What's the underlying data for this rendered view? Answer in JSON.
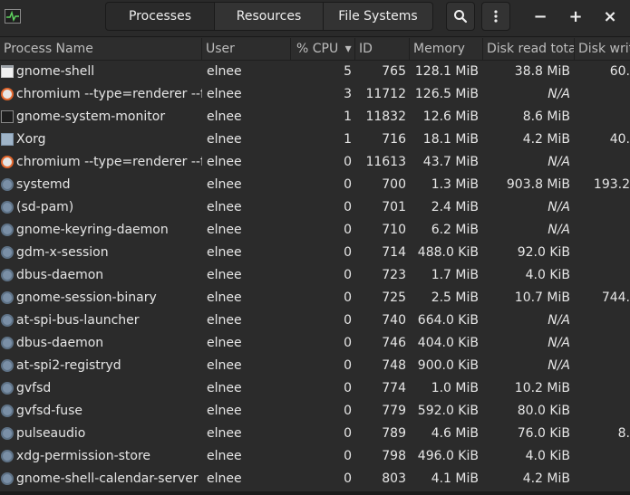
{
  "header": {
    "tabs": [
      {
        "label": "Processes",
        "active": true
      },
      {
        "label": "Resources",
        "active": false
      },
      {
        "label": "File Systems",
        "active": false
      }
    ],
    "search_icon": "search-icon",
    "menu_icon": "kebab-menu-icon",
    "minimize": "−",
    "maximize": "+",
    "close": "×"
  },
  "columns": [
    {
      "key": "name",
      "label": "Process Name"
    },
    {
      "key": "user",
      "label": "User"
    },
    {
      "key": "cpu",
      "label": "% CPU"
    },
    {
      "key": "id",
      "label": "ID"
    },
    {
      "key": "memory",
      "label": "Memory"
    },
    {
      "key": "disk_read",
      "label": "Disk read tota"
    },
    {
      "key": "disk_write",
      "label": "Disk writ"
    }
  ],
  "sort_indicator": "▾",
  "processes": [
    {
      "icon": "window",
      "name": "gnome-shell",
      "user": "elnee",
      "cpu": "5",
      "id": "765",
      "memory": "128.1 MiB",
      "disk_read": "38.8 MiB",
      "disk_write": "60."
    },
    {
      "icon": "chromium",
      "name": "chromium --type=renderer --f",
      "user": "elnee",
      "cpu": "3",
      "id": "11712",
      "memory": "126.5 MiB",
      "disk_read": "N/A",
      "disk_write": ""
    },
    {
      "icon": "monitor",
      "name": "gnome-system-monitor",
      "user": "elnee",
      "cpu": "1",
      "id": "11832",
      "memory": "12.6 MiB",
      "disk_read": "8.6 MiB",
      "disk_write": ""
    },
    {
      "icon": "xorg",
      "name": "Xorg",
      "user": "elnee",
      "cpu": "1",
      "id": "716",
      "memory": "18.1 MiB",
      "disk_read": "4.2 MiB",
      "disk_write": "40."
    },
    {
      "icon": "chromium",
      "name": "chromium --type=renderer --f",
      "user": "elnee",
      "cpu": "0",
      "id": "11613",
      "memory": "43.7 MiB",
      "disk_read": "N/A",
      "disk_write": ""
    },
    {
      "icon": "gear",
      "name": "systemd",
      "user": "elnee",
      "cpu": "0",
      "id": "700",
      "memory": "1.3 MiB",
      "disk_read": "903.8 MiB",
      "disk_write": "193.2"
    },
    {
      "icon": "gear",
      "name": "(sd-pam)",
      "user": "elnee",
      "cpu": "0",
      "id": "701",
      "memory": "2.4 MiB",
      "disk_read": "N/A",
      "disk_write": ""
    },
    {
      "icon": "gear",
      "name": "gnome-keyring-daemon",
      "user": "elnee",
      "cpu": "0",
      "id": "710",
      "memory": "6.2 MiB",
      "disk_read": "N/A",
      "disk_write": ""
    },
    {
      "icon": "gear",
      "name": "gdm-x-session",
      "user": "elnee",
      "cpu": "0",
      "id": "714",
      "memory": "488.0 KiB",
      "disk_read": "92.0 KiB",
      "disk_write": ""
    },
    {
      "icon": "gear",
      "name": "dbus-daemon",
      "user": "elnee",
      "cpu": "0",
      "id": "723",
      "memory": "1.7 MiB",
      "disk_read": "4.0 KiB",
      "disk_write": ""
    },
    {
      "icon": "gear",
      "name": "gnome-session-binary",
      "user": "elnee",
      "cpu": "0",
      "id": "725",
      "memory": "2.5 MiB",
      "disk_read": "10.7 MiB",
      "disk_write": "744."
    },
    {
      "icon": "gear",
      "name": "at-spi-bus-launcher",
      "user": "elnee",
      "cpu": "0",
      "id": "740",
      "memory": "664.0 KiB",
      "disk_read": "N/A",
      "disk_write": ""
    },
    {
      "icon": "gear",
      "name": "dbus-daemon",
      "user": "elnee",
      "cpu": "0",
      "id": "746",
      "memory": "404.0 KiB",
      "disk_read": "N/A",
      "disk_write": ""
    },
    {
      "icon": "gear",
      "name": "at-spi2-registryd",
      "user": "elnee",
      "cpu": "0",
      "id": "748",
      "memory": "900.0 KiB",
      "disk_read": "N/A",
      "disk_write": ""
    },
    {
      "icon": "gear",
      "name": "gvfsd",
      "user": "elnee",
      "cpu": "0",
      "id": "774",
      "memory": "1.0 MiB",
      "disk_read": "10.2 MiB",
      "disk_write": ""
    },
    {
      "icon": "gear",
      "name": "gvfsd-fuse",
      "user": "elnee",
      "cpu": "0",
      "id": "779",
      "memory": "592.0 KiB",
      "disk_read": "80.0 KiB",
      "disk_write": ""
    },
    {
      "icon": "gear",
      "name": "pulseaudio",
      "user": "elnee",
      "cpu": "0",
      "id": "789",
      "memory": "4.6 MiB",
      "disk_read": "76.0 KiB",
      "disk_write": "8."
    },
    {
      "icon": "gear",
      "name": "xdg-permission-store",
      "user": "elnee",
      "cpu": "0",
      "id": "798",
      "memory": "496.0 KiB",
      "disk_read": "4.0 KiB",
      "disk_write": ""
    },
    {
      "icon": "gear",
      "name": "gnome-shell-calendar-server",
      "user": "elnee",
      "cpu": "0",
      "id": "803",
      "memory": "4.1 MiB",
      "disk_read": "4.2 MiB",
      "disk_write": ""
    }
  ]
}
